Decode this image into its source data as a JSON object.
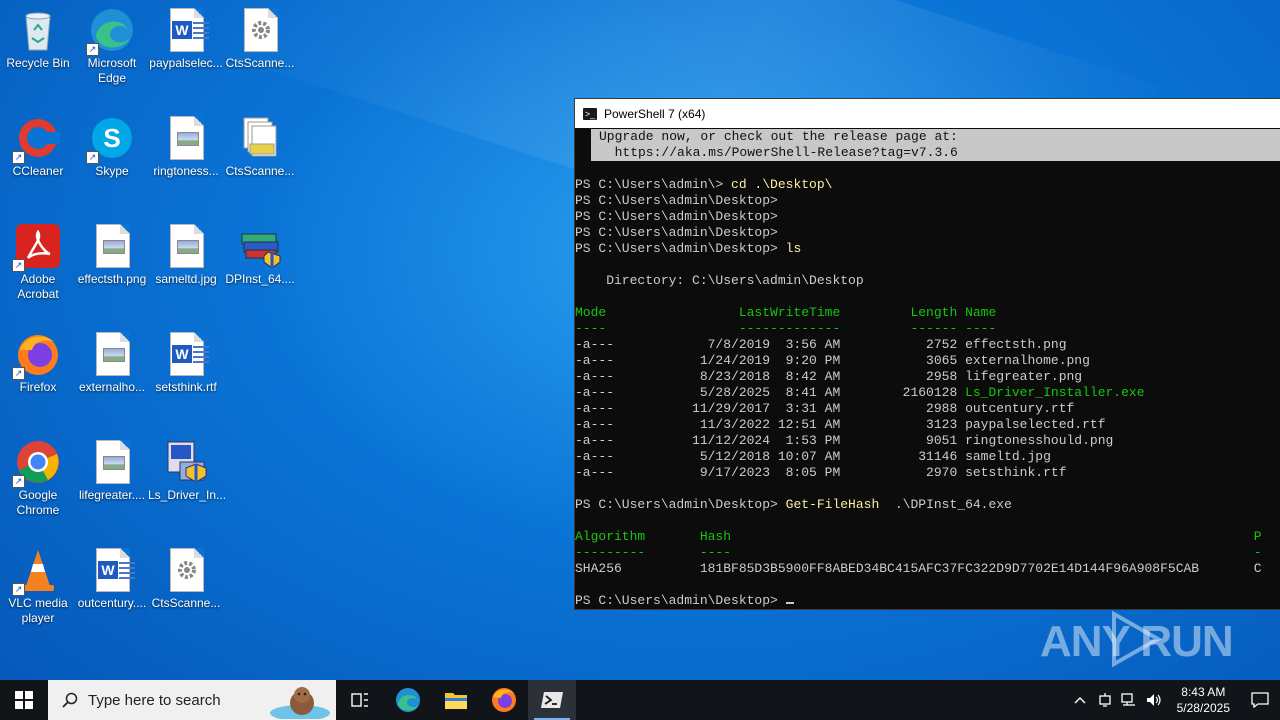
{
  "desktop": {
    "icons": [
      {
        "label": "Recycle Bin"
      },
      {
        "label": "Microsoft Edge"
      },
      {
        "label": "paypalselec..."
      },
      {
        "label": "CtsScanne..."
      },
      {
        "label": "CCleaner"
      },
      {
        "label": "Skype"
      },
      {
        "label": "ringtoness..."
      },
      {
        "label": "CtsScanne..."
      },
      {
        "label": "Adobe Acrobat"
      },
      {
        "label": "effectsth.png"
      },
      {
        "label": "sameltd.jpg"
      },
      {
        "label": "DPInst_64...."
      },
      {
        "label": "Firefox"
      },
      {
        "label": "externalho..."
      },
      {
        "label": "setsthink.rtf"
      },
      {
        "label": "Google Chrome"
      },
      {
        "label": "lifegreater...."
      },
      {
        "label": "Ls_Driver_In..."
      },
      {
        "label": "VLC media player"
      },
      {
        "label": "outcentury...."
      },
      {
        "label": "CtsScanne..."
      }
    ]
  },
  "powershell": {
    "title": "PowerShell 7 (x64)",
    "banner": [
      "Upgrade now, or check out the release page at:",
      "  https://aka.ms/PowerShell-Release?tag=v7.3.6"
    ],
    "prompt": "PS C:\\Users\\admin\\Desktop> ",
    "prompt_first": "PS C:\\Users\\admin\\> ",
    "cmd_cd": "cd .\\Desktop\\",
    "cmd_ls": "ls",
    "directory": "    Directory: C:\\Users\\admin\\Desktop",
    "table_header": "Mode                 LastWriteTime         Length Name",
    "table_rule": "----                 -------------         ------ ----",
    "files": [
      {
        "prefix": "-a---            7/8/2019  3:56 AM           2752 ",
        "name": "effectsth.png",
        "exe": false
      },
      {
        "prefix": "-a---           1/24/2019  9:20 PM           3065 ",
        "name": "externalhome.png",
        "exe": false
      },
      {
        "prefix": "-a---           8/23/2018  8:42 AM           2958 ",
        "name": "lifegreater.png",
        "exe": false
      },
      {
        "prefix": "-a---           5/28/2025  8:41 AM        2160128 ",
        "name": "Ls_Driver_Installer.exe",
        "exe": true
      },
      {
        "prefix": "-a---          11/29/2017  3:31 AM           2988 ",
        "name": "outcentury.rtf",
        "exe": false
      },
      {
        "prefix": "-a---           11/3/2022 12:51 AM           3123 ",
        "name": "paypalselected.rtf",
        "exe": false
      },
      {
        "prefix": "-a---          11/12/2024  1:53 PM           9051 ",
        "name": "ringtonesshould.png",
        "exe": false
      },
      {
        "prefix": "-a---           5/12/2018 10:07 AM          31146 ",
        "name": "sameltd.jpg",
        "exe": false
      },
      {
        "prefix": "-a---           9/17/2023  8:05 PM           2970 ",
        "name": "setsthink.rtf",
        "exe": false
      }
    ],
    "cmd_hash": "Get-FileHash",
    "cmd_hash_arg": "  .\\DPInst_64.exe",
    "hash_header": "Algorithm       Hash                                                                   P",
    "hash_rule": "---------       ----                                                                   -",
    "hash_row": "SHA256          181BF85D3B5900FF8ABED34BC415AFC37FC322D9D7702E14D144F96A908F5CAB       C"
  },
  "watermark": "ANY RUN",
  "taskbar": {
    "search_placeholder": "Type here to search",
    "time": "8:43 AM",
    "date": "5/28/2025"
  },
  "colors": {
    "terminal_bg": "#0c0c0c",
    "terminal_green": "#16c60c",
    "terminal_yellow": "#f9f1a5"
  }
}
